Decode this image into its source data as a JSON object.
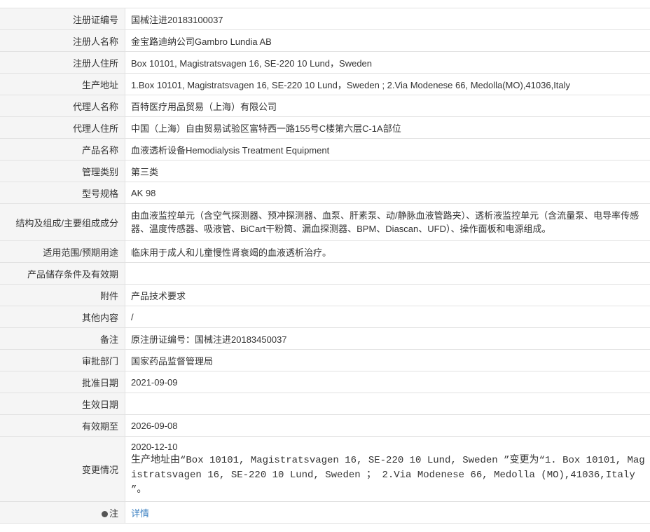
{
  "rows": [
    {
      "label": "注册证编号",
      "value": "国械注进20183100037"
    },
    {
      "label": "注册人名称",
      "value": "金宝路迪纳公司Gambro Lundia AB"
    },
    {
      "label": "注册人住所",
      "value": "Box 10101, Magistratsvagen 16, SE-220 10 Lund，Sweden"
    },
    {
      "label": "生产地址",
      "value": "1.Box 10101, Magistratsvagen 16, SE-220 10 Lund，Sweden ; 2.Via Modenese 66, Medolla(MO),41036,Italy"
    },
    {
      "label": "代理人名称",
      "value": "百特医疗用品贸易（上海）有限公司"
    },
    {
      "label": "代理人住所",
      "value": "中国（上海）自由贸易试验区富特西一路155号C楼第六层C-1A部位"
    },
    {
      "label": "产品名称",
      "value": "血液透析设备Hemodialysis Treatment Equipment"
    },
    {
      "label": "管理类别",
      "value": "第三类"
    },
    {
      "label": "型号规格",
      "value": "AK 98"
    },
    {
      "label": "结构及组成/主要组成成分",
      "value": "由血液监控单元（含空气探测器、预冲探测器、血泵、肝素泵、动/静脉血液管路夹）、透析液监控单元（含流量泵、电导率传感器、温度传感器、吸液管、BiCart干粉筒、漏血探测器、BPM、Diascan、UFD）、操作面板和电源组成。"
    },
    {
      "label": "适用范围/预期用途",
      "value": "临床用于成人和儿童慢性肾衰竭的血液透析治疗。"
    },
    {
      "label": "产品储存条件及有效期",
      "value": ""
    },
    {
      "label": "附件",
      "value": "产品技术要求"
    },
    {
      "label": "其他内容",
      "value": "/"
    },
    {
      "label": "备注",
      "value": "原注册证编号：国械注进20183450037"
    },
    {
      "label": "审批部门",
      "value": "国家药品监督管理局"
    },
    {
      "label": "批准日期",
      "value": "2021-09-09"
    },
    {
      "label": "生效日期",
      "value": ""
    },
    {
      "label": "有效期至",
      "value": "2026-09-08"
    }
  ],
  "change": {
    "label": "变更情况",
    "date": "2020-12-10",
    "text": "生产地址由“Box 10101, Magistratsvagen 16, SE-220 10 Lund, Sweden ”变更为“1. Box 10101, Magistratsvagen 16, SE-220 10 Lund, Sweden ； 2.Via Modenese 66, Medolla (MO),41036,Italy ”。"
  },
  "note": {
    "label": "注",
    "icon": "info-dot-icon",
    "link_text": "详情"
  }
}
